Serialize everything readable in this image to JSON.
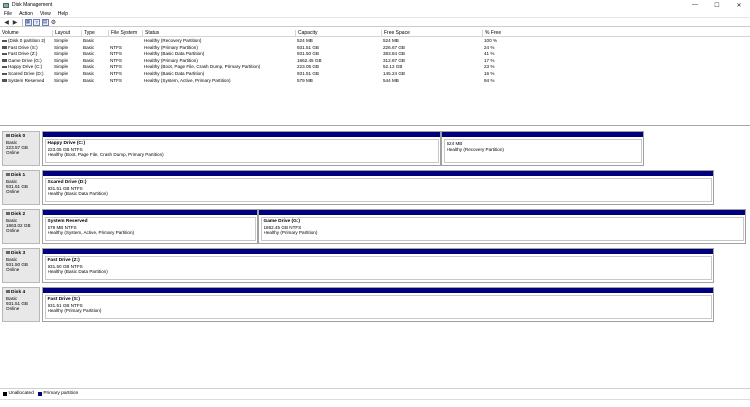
{
  "window": {
    "title": "Disk Management",
    "controls": [
      "—",
      "☐",
      "✕"
    ]
  },
  "menu": [
    "File",
    "Action",
    "View",
    "Help"
  ],
  "toolbar": {
    "icons": [
      "back-icon",
      "forward-icon",
      "properties-icon",
      "help-icon",
      "console-icon",
      "settings-icon"
    ]
  },
  "volume_table": {
    "columns": [
      "Volume",
      "Layout",
      "Type",
      "File System",
      "Status",
      "Capacity",
      "Free Space",
      "% Free"
    ],
    "rows": [
      [
        "(Disk 0 partition 2)",
        "Simple",
        "Basic",
        "",
        "Healthy (Recovery Partition)",
        "524 MB",
        "524 MB",
        "100 %"
      ],
      [
        "Fast Drive (S:)",
        "Simple",
        "Basic",
        "NTFS",
        "Healthy (Primary Partition)",
        "931.51 GB",
        "226.67 GB",
        "24 %"
      ],
      [
        "Fast Drive (Z:)",
        "Simple",
        "Basic",
        "NTFS",
        "Healthy (Basic Data Partition)",
        "931.50 GB",
        "383.84 GB",
        "41 %"
      ],
      [
        "Game Drive (G:)",
        "Simple",
        "Basic",
        "NTFS",
        "Healthy (Primary Partition)",
        "1862.45 GB",
        "312.87 GB",
        "17 %"
      ],
      [
        "Happy Drive (C:)",
        "Simple",
        "Basic",
        "NTFS",
        "Healthy (Boot, Page File, Crash Dump, Primary Partition)",
        "223.05 GB",
        "52.12 GB",
        "23 %"
      ],
      [
        "Scared Drive (D:)",
        "Simple",
        "Basic",
        "NTFS",
        "Healthy (Basic Data Partition)",
        "931.51 GB",
        "145.24 GB",
        "16 %"
      ],
      [
        "System Reserved",
        "Simple",
        "Basic",
        "NTFS",
        "Healthy (System, Active, Primary Partition)",
        "579 MB",
        "544 MB",
        "94 %"
      ]
    ]
  },
  "disks": [
    {
      "name": "Disk 0",
      "type": "Basic",
      "size": "223.57 GB",
      "status": "Online",
      "partitions": [
        {
          "name": "Happy Drive  (C:)",
          "size": "223.05 GB NTFS",
          "status": "Healthy (Boot, Page File, Crash Dump, Primary Partition)"
        },
        {
          "name": "",
          "size": "524 MB",
          "status": "Healthy (Recovery Partition)"
        }
      ]
    },
    {
      "name": "Disk 1",
      "type": "Basic",
      "size": "931.51 GB",
      "status": "Online",
      "partitions": [
        {
          "name": "Scared Drive  (D:)",
          "size": "931.51 GB NTFS",
          "status": "Healthy (Basic Data Partition)"
        }
      ]
    },
    {
      "name": "Disk 2",
      "type": "Basic",
      "size": "1863.02 GB",
      "status": "Online",
      "partitions": [
        {
          "name": "System Reserved",
          "size": "579 MB NTFS",
          "status": "Healthy (System, Active, Primary Partition)"
        },
        {
          "name": "Game Drive  (G:)",
          "size": "1862.45 GB NTFS",
          "status": "Healthy (Primary Partition)"
        }
      ]
    },
    {
      "name": "Disk 3",
      "type": "Basic",
      "size": "931.50 GB",
      "status": "Online",
      "partitions": [
        {
          "name": "Fast Drive  (Z:)",
          "size": "931.50 GB NTFS",
          "status": "Healthy (Basic Data Partition)"
        }
      ]
    },
    {
      "name": "Disk 4",
      "type": "Basic",
      "size": "931.51 GB",
      "status": "Online",
      "partitions": [
        {
          "name": "Fast Drive  (S:)",
          "size": "931.51 GB NTFS",
          "status": "Healthy (Primary Partition)"
        }
      ]
    }
  ],
  "legend": [
    {
      "label": "Unallocated",
      "color": "#000000"
    },
    {
      "label": "Primary partition",
      "color": "#00007e"
    }
  ]
}
